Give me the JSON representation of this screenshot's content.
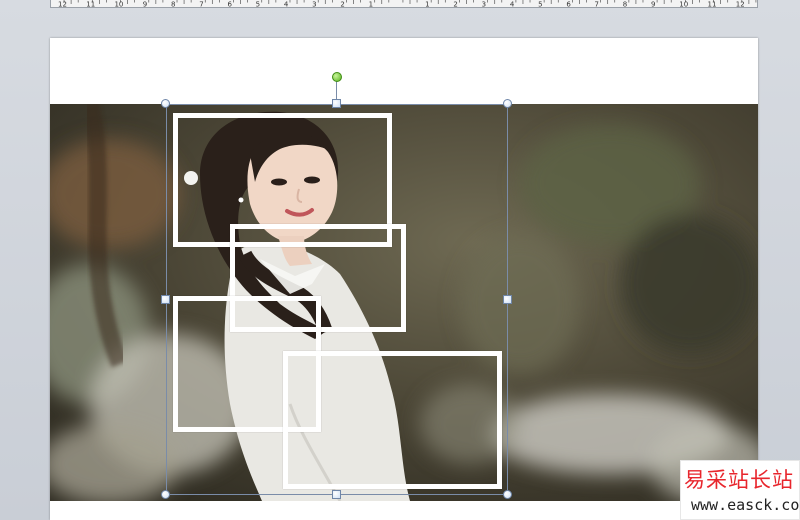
{
  "app": {
    "window_area": "presentation-editor"
  },
  "ruler": {
    "labels": [
      "12",
      "11",
      "10",
      "9",
      "8",
      "7",
      "6",
      "5",
      "4",
      "3",
      "2",
      "1",
      "",
      "1",
      "2",
      "3",
      "4",
      "5",
      "6",
      "7",
      "8",
      "9",
      "10",
      "11",
      "12"
    ]
  },
  "slide": {
    "photo": {
      "description_label": "",
      "icon": "photo-image"
    },
    "frames_count": 4
  },
  "selection": {
    "state": "grouped-shapes-selected"
  },
  "watermark": {
    "title": "易采站长站",
    "url": "www.easck.com",
    "title_color": "#e8262d"
  },
  "colors": {
    "frame": "#ffffff",
    "selection_border": "#7a8ca8",
    "rotate_handle": "#58b31f"
  }
}
